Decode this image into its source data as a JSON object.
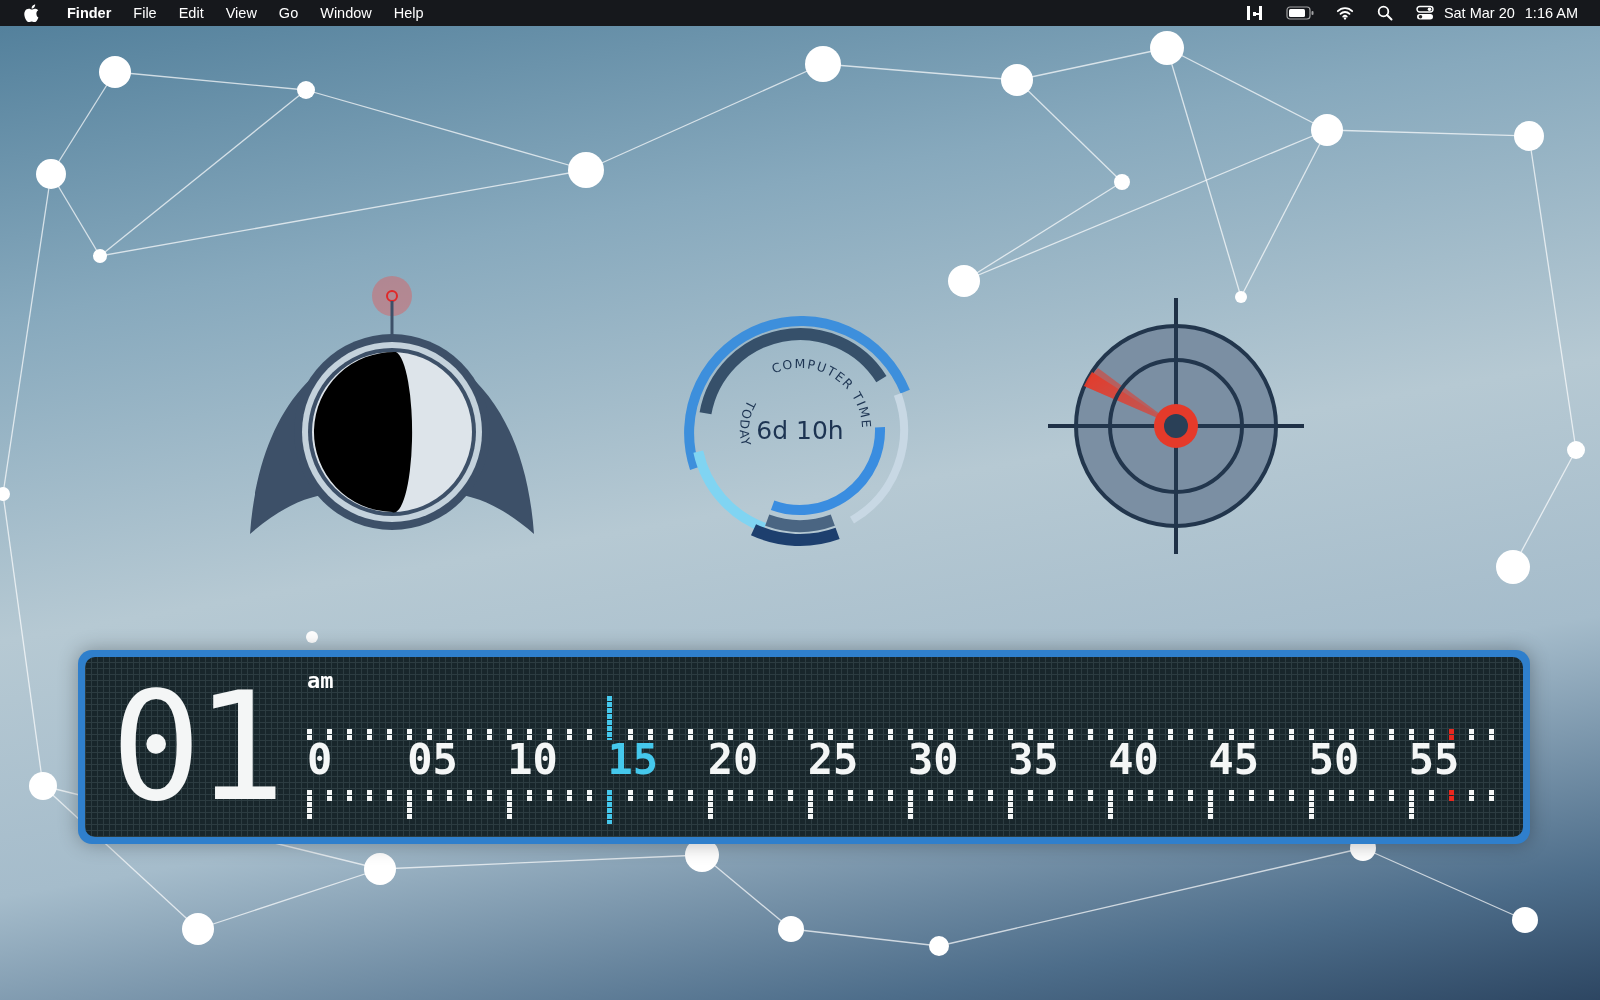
{
  "menu_bar": {
    "app_name": "Finder",
    "menus": [
      "File",
      "Edit",
      "View",
      "Go",
      "Window",
      "Help"
    ],
    "date": "Sat Mar 20",
    "time": "1:16 AM"
  },
  "computer_time": {
    "value": "6d 10h",
    "arc_label": "COMPUTER TIME",
    "sub_label": "TODAY"
  },
  "led_clock": {
    "hour": "01",
    "period": "am",
    "minutes": [
      {
        "label": "0",
        "selected": false
      },
      {
        "label": "05",
        "selected": false
      },
      {
        "label": "10",
        "selected": false
      },
      {
        "label": "15",
        "selected": true
      },
      {
        "label": "20",
        "selected": false
      },
      {
        "label": "25",
        "selected": false
      },
      {
        "label": "30",
        "selected": false
      },
      {
        "label": "35",
        "selected": false
      },
      {
        "label": "40",
        "selected": false
      },
      {
        "label": "45",
        "selected": false
      },
      {
        "label": "50",
        "selected": false
      },
      {
        "label": "55",
        "selected": false
      }
    ],
    "seconds_marker": {
      "level": 0.95
    }
  }
}
